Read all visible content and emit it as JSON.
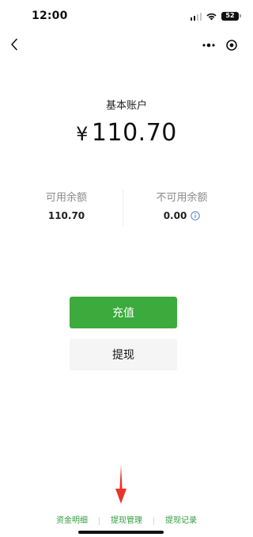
{
  "status_bar": {
    "time": "12:00",
    "battery": "52"
  },
  "nav": {
    "back_icon": "chevron-left-icon",
    "more_icon": "more-dots-icon",
    "close_icon": "target-circle-icon"
  },
  "account": {
    "title": "基本账户",
    "currency_symbol": "¥",
    "balance": "110.70"
  },
  "sub_balances": {
    "available_label": "可用余额",
    "available_value": "110.70",
    "unavailable_label": "不可用余额",
    "unavailable_value": "0.00",
    "info_icon": "info-circle-icon"
  },
  "actions": {
    "recharge_label": "充值",
    "withdraw_label": "提现"
  },
  "bottom_links": {
    "details": "资金明细",
    "withdraw_manage": "提现管理",
    "withdraw_records": "提现记录"
  },
  "colors": {
    "accent_green": "#3caa3c",
    "link_green": "#2e9e3e",
    "annotation_red": "#e8352b"
  }
}
